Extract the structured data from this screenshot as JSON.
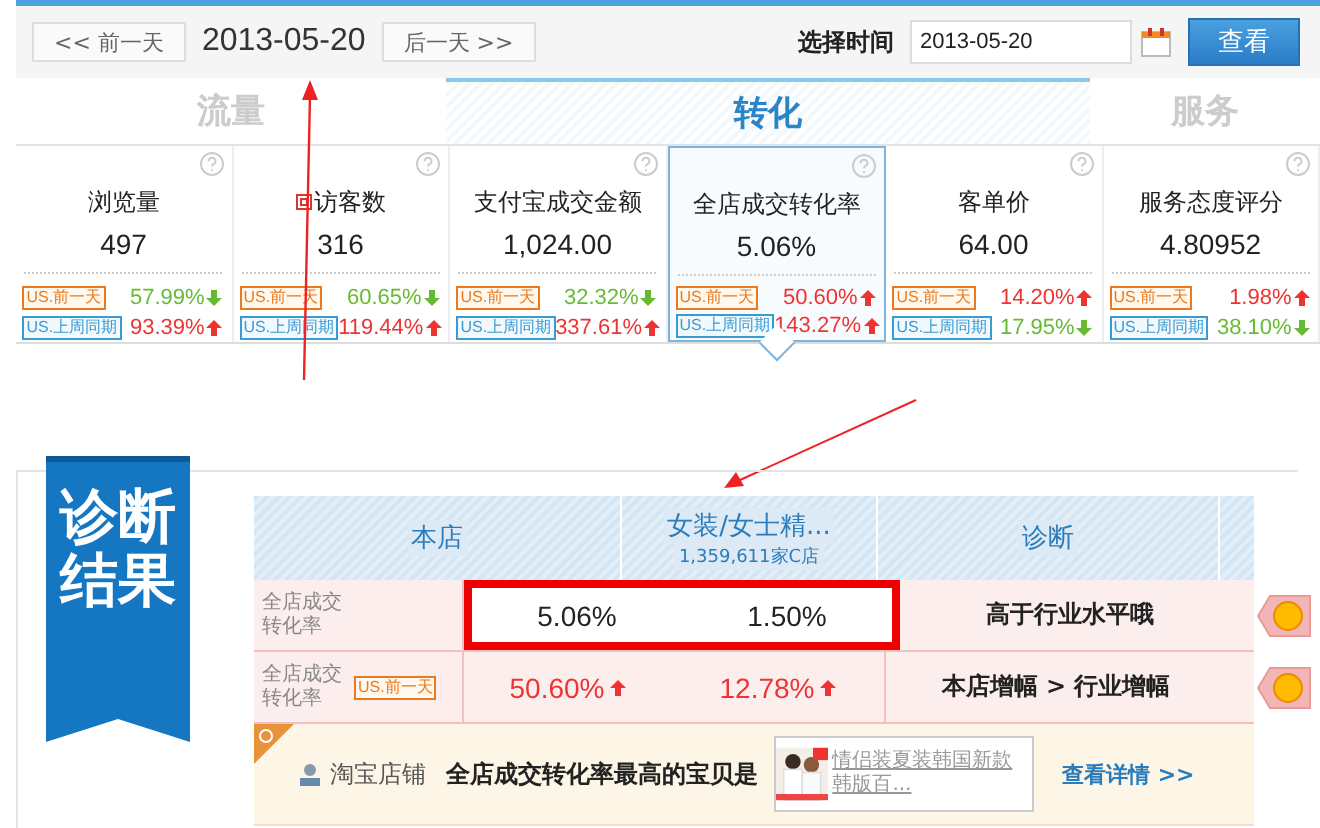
{
  "toolbar": {
    "prev_button": "<< 前一天",
    "date": "2013-05-20",
    "next_button": "后一天 >>",
    "picker_label": "选择时间",
    "picker_value": "2013-05-20",
    "view_button": "查看"
  },
  "tabs": [
    {
      "label": "流量",
      "selected": false
    },
    {
      "label": "转化",
      "selected": true
    },
    {
      "label": "服务",
      "selected": false
    }
  ],
  "metrics": [
    {
      "title": "浏览量",
      "value": "497",
      "selected": false,
      "flag": false,
      "compare": [
        {
          "tag": "US.前一天",
          "kind": "day",
          "pct": "57.99%",
          "rising": false
        },
        {
          "tag": "US.上周同期",
          "kind": "week",
          "pct": "93.39%",
          "rising": true
        }
      ]
    },
    {
      "title": "访客数",
      "value": "316",
      "selected": false,
      "flag": true,
      "compare": [
        {
          "tag": "US.前一天",
          "kind": "day",
          "pct": "60.65%",
          "rising": false
        },
        {
          "tag": "US.上周同期",
          "kind": "week",
          "pct": "119.44%",
          "rising": true
        }
      ]
    },
    {
      "title": "支付宝成交金额",
      "value": "1,024.00",
      "selected": false,
      "flag": false,
      "compare": [
        {
          "tag": "US.前一天",
          "kind": "day",
          "pct": "32.32%",
          "rising": false
        },
        {
          "tag": "US.上周同期",
          "kind": "week",
          "pct": "337.61%",
          "rising": true
        }
      ]
    },
    {
      "title": "全店成交转化率",
      "value": "5.06%",
      "selected": true,
      "flag": false,
      "compare": [
        {
          "tag": "US.前一天",
          "kind": "day",
          "pct": "50.60%",
          "rising": true
        },
        {
          "tag": "US.上周同期",
          "kind": "week",
          "pct": "143.27%",
          "rising": true
        }
      ]
    },
    {
      "title": "客单价",
      "value": "64.00",
      "selected": false,
      "flag": false,
      "compare": [
        {
          "tag": "US.前一天",
          "kind": "day",
          "pct": "14.20%",
          "rising": true
        },
        {
          "tag": "US.上周同期",
          "kind": "week",
          "pct": "17.95%",
          "rising": false
        }
      ]
    },
    {
      "title": "服务态度评分",
      "value": "4.80952",
      "selected": false,
      "flag": false,
      "compare": [
        {
          "tag": "US.前一天",
          "kind": "day",
          "pct": "1.98%",
          "rising": true
        },
        {
          "tag": "US.上周同期",
          "kind": "week",
          "pct": "38.10%",
          "rising": false
        }
      ]
    }
  ],
  "diagnosis": {
    "ribbon": "诊断结果",
    "columns": [
      {
        "label": "本店"
      },
      {
        "label": "女装/女士精...",
        "sub": "1,359,611家C店"
      },
      {
        "label": "诊断"
      }
    ],
    "rows": [
      {
        "label": "全店成交转化率",
        "own": "5.06%",
        "industry": "1.50%",
        "verdict": "高于行业水平哦",
        "highlighted": true
      },
      {
        "label": "全店成交转化率",
        "tag": "US.前一天",
        "own": "50.60%",
        "own_rising": true,
        "industry": "12.78%",
        "industry_rising": true,
        "verdict": "本店增幅 > 行业增幅",
        "highlighted": false
      }
    ],
    "footer": {
      "source": "淘宝店铺",
      "text": "全店成交转化率最高的宝贝是",
      "product_link": "情侣装夏装韩国新款韩版百...",
      "details_link": "查看详情 >>"
    }
  }
}
